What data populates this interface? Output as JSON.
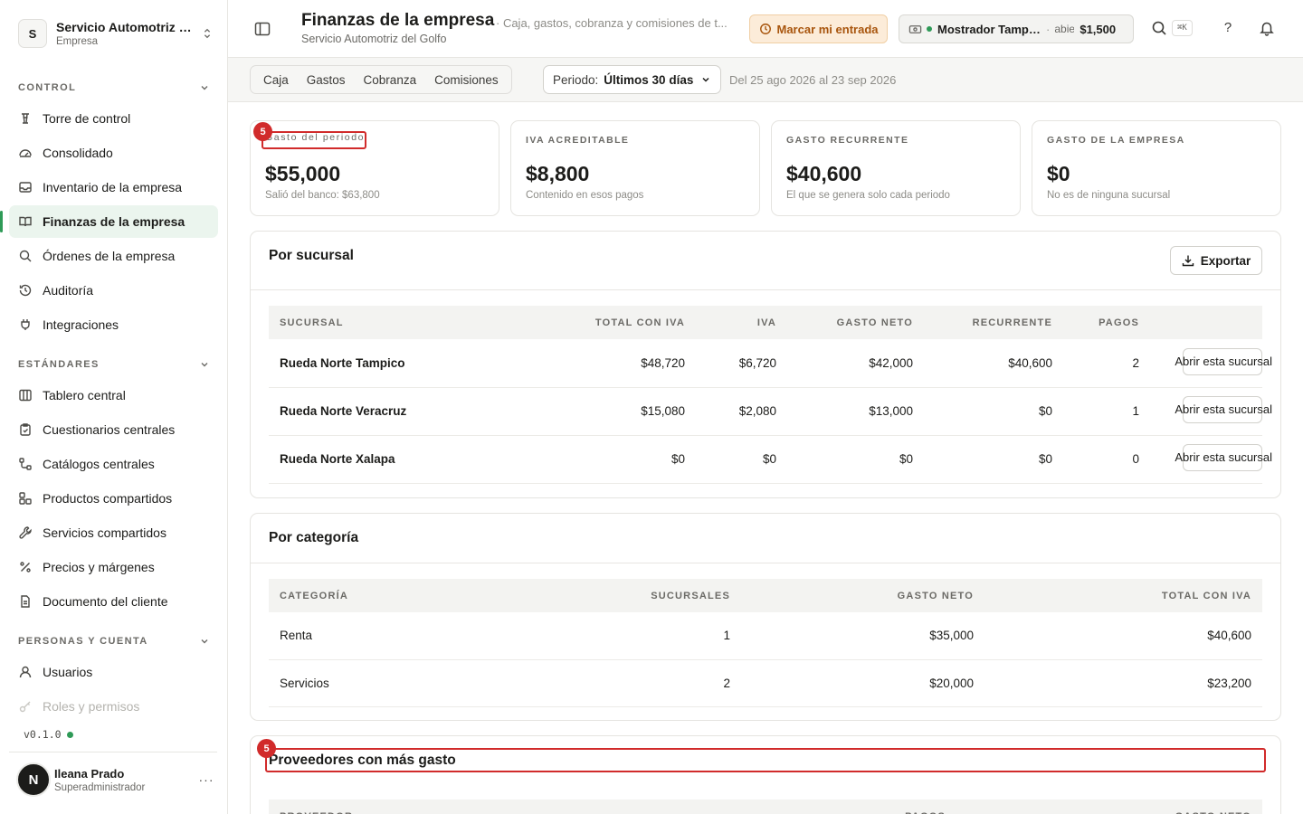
{
  "org": {
    "initial": "S",
    "name": "Servicio Automotriz del Golfo",
    "type": "Empresa"
  },
  "sections": [
    {
      "title": "CONTROL",
      "items": [
        "Torre de control",
        "Consolidado",
        "Inventario de la empresa",
        "Finanzas de la empresa",
        "Órdenes de la empresa",
        "Auditoría",
        "Integraciones"
      ]
    },
    {
      "title": "ESTÁNDARES",
      "items": [
        "Tablero central",
        "Cuestionarios centrales",
        "Catálogos centrales",
        "Productos compartidos",
        "Servicios compartidos",
        "Precios y márgenes",
        "Documento del cliente"
      ]
    },
    {
      "title": "PERSONAS Y CUENTA",
      "items": [
        "Usuarios",
        "Roles y permisos"
      ]
    }
  ],
  "version": "v0.1.0",
  "user": {
    "initial": "N",
    "name": "Ileana Prado",
    "role": "Superadministrador",
    "more": "···"
  },
  "header": {
    "title": "Finanzas de la empresa",
    "org": "Servicio Automotriz del Golfo",
    "desc": "· Caja, gastos, cobranza y comisiones de t...",
    "checkin": "Marcar mi entrada",
    "register_name": "Mostrador Tampi...",
    "register_status": "abie",
    "register_amount": "$1,500",
    "kbd": "⌘K",
    "help": "?"
  },
  "tabs": [
    "Caja",
    "Gastos",
    "Cobranza",
    "Comisiones"
  ],
  "period": {
    "label": "Periodo:",
    "value": "Últimos 30 días"
  },
  "range": "Del 25 ago 2026 al 23 sep 2026",
  "stats": [
    {
      "label": "Gasto del periodo",
      "value": "$55,000",
      "sub": "Salió del banco: $63,800"
    },
    {
      "label": "IVA ACREDITABLE",
      "value": "$8,800",
      "sub": "Contenido en esos pagos"
    },
    {
      "label": "GASTO RECURRENTE",
      "value": "$40,600",
      "sub": "El que se genera solo cada periodo"
    },
    {
      "label": "GASTO DE LA EMPRESA",
      "value": "$0",
      "sub": "No es de ninguna sucursal"
    }
  ],
  "badge": "5",
  "branches": {
    "title": "Por sucursal",
    "export": "Exportar",
    "columns": [
      "SUCURSAL",
      "TOTAL CON IVA",
      "IVA",
      "GASTO NETO",
      "RECURRENTE",
      "PAGOS"
    ],
    "action": "Abrir esta sucursal",
    "rows": [
      [
        "Rueda Norte Tampico",
        "$48,720",
        "$6,720",
        "$42,000",
        "$40,600",
        "2"
      ],
      [
        "Rueda Norte Veracruz",
        "$15,080",
        "$2,080",
        "$13,000",
        "$0",
        "1"
      ],
      [
        "Rueda Norte Xalapa",
        "$0",
        "$0",
        "$0",
        "$0",
        "0"
      ]
    ]
  },
  "categories": {
    "title": "Por categoría",
    "columns": [
      "CATEGORÍA",
      "SUCURSALES",
      "GASTO NETO",
      "TOTAL CON IVA"
    ],
    "rows": [
      [
        "Renta",
        "1",
        "$35,000",
        "$40,600"
      ],
      [
        "Servicios",
        "2",
        "$20,000",
        "$23,200"
      ]
    ]
  },
  "suppliers": {
    "title": "Proveedores con más gasto",
    "columns": [
      "PROVEEDOR",
      "PAGOS",
      "GASTO NETO"
    ]
  }
}
